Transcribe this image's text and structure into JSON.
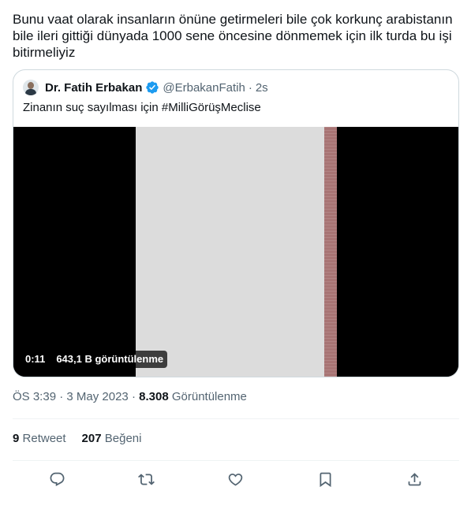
{
  "tweet": {
    "text": "Bunu vaat olarak insanların önüne getirmeleri bile çok korkunç arabistanın bile ileri gittiği dünyada 1000 sene öncesine dönmemek için ilk turda bu işi bitirmeliyiz"
  },
  "quote": {
    "author_name": "Dr. Fatih Erbakan",
    "author_handle": "@ErbakanFatih",
    "separator": "·",
    "age": "2s",
    "text": "Zinanın suç sayılması için #MilliGörüşMeclise",
    "video": {
      "duration": "0:11",
      "views": "643,1 B görüntülenme"
    }
  },
  "meta": {
    "time": "ÖS 3:39",
    "separator": "·",
    "date": "3 May 2023",
    "views_count": "8.308",
    "views_label": "Görüntülenme"
  },
  "stats": {
    "retweet_count": "9",
    "retweet_label": "Retweet",
    "like_count": "207",
    "like_label": "Beğeni"
  },
  "icons": {
    "verified": "verified-badge-icon",
    "reply": "reply-icon",
    "retweet": "retweet-icon",
    "like": "like-icon",
    "bookmark": "bookmark-icon",
    "share": "share-icon"
  },
  "colors": {
    "verified": "#1d9bf0",
    "secondary_text": "#536471",
    "border": "#cfd9de"
  }
}
